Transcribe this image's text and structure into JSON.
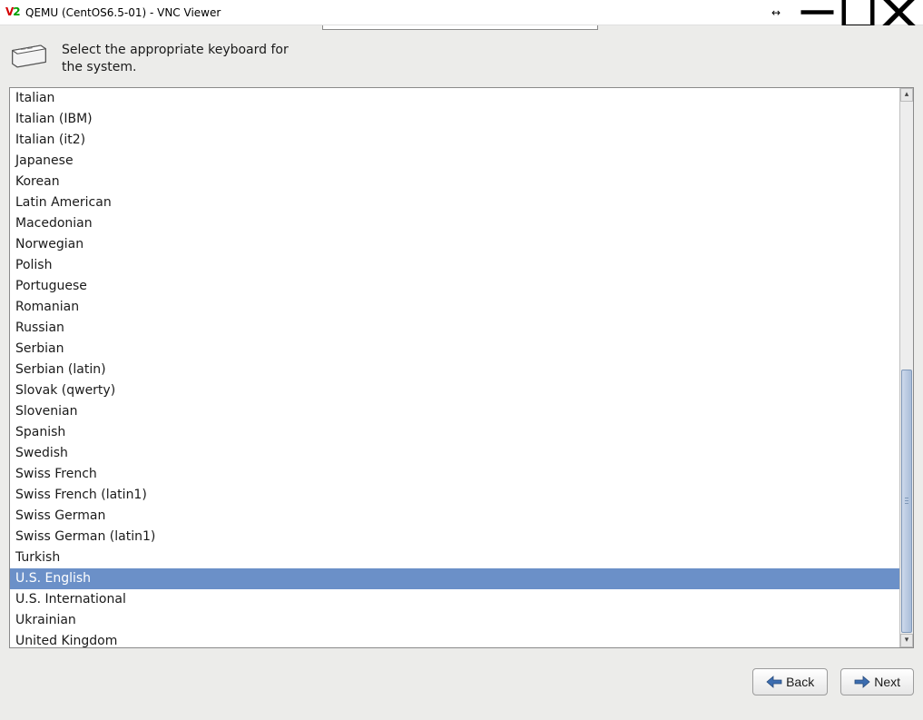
{
  "window": {
    "title": "QEMU (CentOS6.5-01) - VNC Viewer"
  },
  "header": {
    "prompt": "Select the appropriate keyboard for the system."
  },
  "listbox": {
    "items": [
      "Italian",
      "Italian (IBM)",
      "Italian (it2)",
      "Japanese",
      "Korean",
      "Latin American",
      "Macedonian",
      "Norwegian",
      "Polish",
      "Portuguese",
      "Romanian",
      "Russian",
      "Serbian",
      "Serbian (latin)",
      "Slovak (qwerty)",
      "Slovenian",
      "Spanish",
      "Swedish",
      "Swiss French",
      "Swiss French (latin1)",
      "Swiss German",
      "Swiss German (latin1)",
      "Turkish",
      "U.S. English",
      "U.S. International",
      "Ukrainian",
      "United Kingdom"
    ],
    "selected_index": 23
  },
  "footer": {
    "back_label": "Back",
    "next_label": "Next"
  }
}
